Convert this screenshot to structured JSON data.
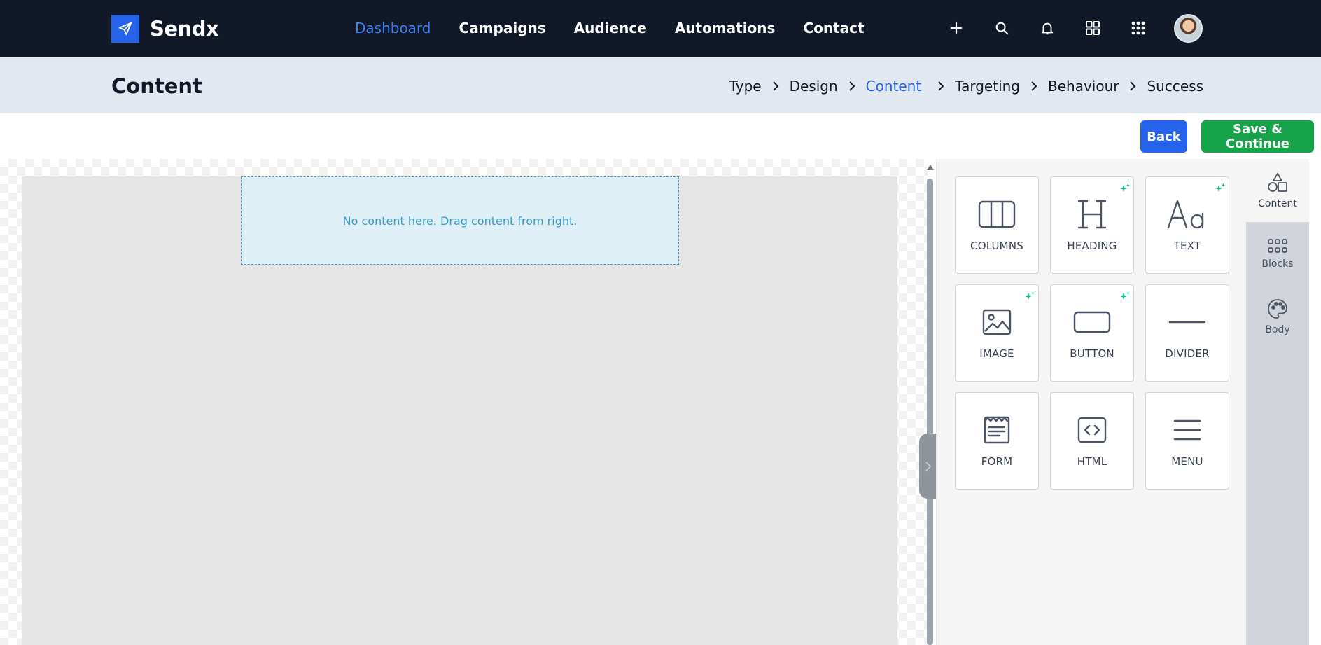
{
  "brand": {
    "name": "Sendx",
    "logo_icon": "paper-plane-icon",
    "accent": "#2563eb"
  },
  "nav": {
    "items": [
      {
        "label": "Dashboard",
        "active": true
      },
      {
        "label": "Campaigns"
      },
      {
        "label": "Audience"
      },
      {
        "label": "Automations"
      },
      {
        "label": "Contact"
      }
    ],
    "icons": [
      "plus-icon",
      "search-icon",
      "bell-icon",
      "grid-icon",
      "apps-icon"
    ]
  },
  "subheader": {
    "title": "Content",
    "steps": [
      {
        "label": "Type"
      },
      {
        "label": "Design"
      },
      {
        "label": "Content",
        "active": true
      },
      {
        "label": "Targeting"
      },
      {
        "label": "Behaviour"
      },
      {
        "label": "Success"
      }
    ]
  },
  "actions": {
    "back_label": "Back",
    "save_label": "Save & Continue",
    "back_color": "#2563eb",
    "save_color": "#16a34a"
  },
  "canvas": {
    "placeholder": "No content here. Drag content from right."
  },
  "tools": [
    {
      "label": "COLUMNS",
      "icon": "columns-icon",
      "ai": false
    },
    {
      "label": "HEADING",
      "icon": "heading-icon",
      "ai": true
    },
    {
      "label": "TEXT",
      "icon": "text-icon",
      "ai": true
    },
    {
      "label": "IMAGE",
      "icon": "image-icon",
      "ai": true
    },
    {
      "label": "BUTTON",
      "icon": "button-icon",
      "ai": true
    },
    {
      "label": "DIVIDER",
      "icon": "divider-icon",
      "ai": false
    },
    {
      "label": "FORM",
      "icon": "form-icon",
      "ai": false
    },
    {
      "label": "HTML",
      "icon": "html-icon",
      "ai": false
    },
    {
      "label": "MENU",
      "icon": "menu-icon",
      "ai": false
    }
  ],
  "side_tabs": [
    {
      "label": "Content",
      "icon": "shapes-icon",
      "active": true
    },
    {
      "label": "Blocks",
      "icon": "blocks-icon"
    },
    {
      "label": "Body",
      "icon": "palette-icon"
    }
  ]
}
